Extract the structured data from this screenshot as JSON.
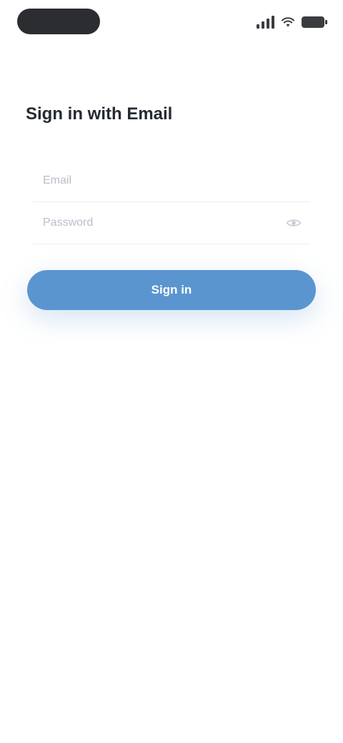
{
  "status_bar": {
    "time": "",
    "icons": [
      "signal-icon",
      "wifi-icon",
      "battery-icon"
    ]
  },
  "subtitle": "",
  "page": {
    "title": "Sign in with Email"
  },
  "form": {
    "email": {
      "value": "",
      "placeholder": "Email"
    },
    "password": {
      "value": "",
      "placeholder": "Password"
    }
  },
  "actions": {
    "primary_label": "Sign in"
  },
  "footer_hint": "",
  "colors": {
    "primary": "#5b95d0",
    "status_pill": "#2b2d31",
    "background": "#ffffff"
  }
}
